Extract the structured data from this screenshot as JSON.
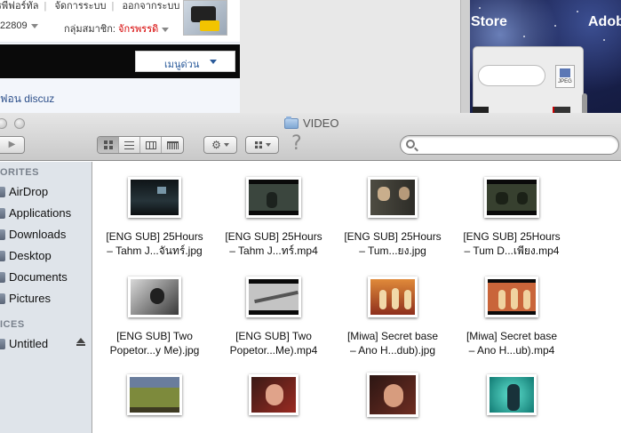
{
  "web": {
    "links": [
      "รพีฟอร์ทัล",
      "จัดการระบบ",
      "ออกจากระบบ"
    ],
    "stats": "22809",
    "group_label": "กลุ่มสมาชิก:",
    "group_value": "จักรพรรดิ",
    "menu_label": "เมนูด่วน",
    "breadcrumb": "ฟอน  discuz"
  },
  "background_apps": {
    "store_text": "Store",
    "adobe_text": "Adob",
    "jpeg_label": "JPEG"
  },
  "finder": {
    "title": "VIDEO",
    "search_placeholder": "",
    "help_glyph": "?",
    "sidebar": {
      "favorites_header": "ORITES",
      "favorites": [
        "AirDrop",
        "Applications",
        "Downloads",
        "Desktop",
        "Documents",
        "Pictures"
      ],
      "devices_header": "ICES",
      "devices": [
        "Untitled"
      ]
    },
    "files": [
      {
        "line1": "[ENG SUB] 25Hours",
        "line2": "– Tahm J...จันทร์.jpg",
        "thumb": "#1b2226"
      },
      {
        "line1": "[ENG SUB] 25Hours",
        "line2": "– Tahm J...ทร์.mp4",
        "thumb": "#2c342d"
      },
      {
        "line1": "[ENG SUB] 25Hours",
        "line2": "– Tum...ยง.jpg",
        "thumb": "#3a3a33"
      },
      {
        "line1": "[ENG SUB] 25Hours",
        "line2": "– Tum D...เพียง.mp4",
        "thumb": "#2a2f28"
      },
      {
        "line1": "[ENG SUB] Two",
        "line2": "Popetor...y Me).jpg",
        "thumb": "#6d6d6d"
      },
      {
        "line1": "[ENG SUB] Two",
        "line2": "Popetor...Me).mp4",
        "thumb": "#9a9a9a"
      },
      {
        "line1": "[Miwa] Secret base",
        "line2": "– Ano H...dub).jpg",
        "thumb": "#b4522c"
      },
      {
        "line1": "[Miwa] Secret base",
        "line2": "– Ano H...ub).mp4",
        "thumb": "#9c4a30"
      },
      {
        "line1": "",
        "line2": "",
        "thumb": "#6f7a3a"
      },
      {
        "line1": "",
        "line2": "",
        "thumb": "#8a2e26"
      },
      {
        "line1": "",
        "line2": "",
        "thumb": "#5a2a24"
      },
      {
        "line1": "",
        "line2": "",
        "thumb": "#1f8e86"
      }
    ]
  }
}
